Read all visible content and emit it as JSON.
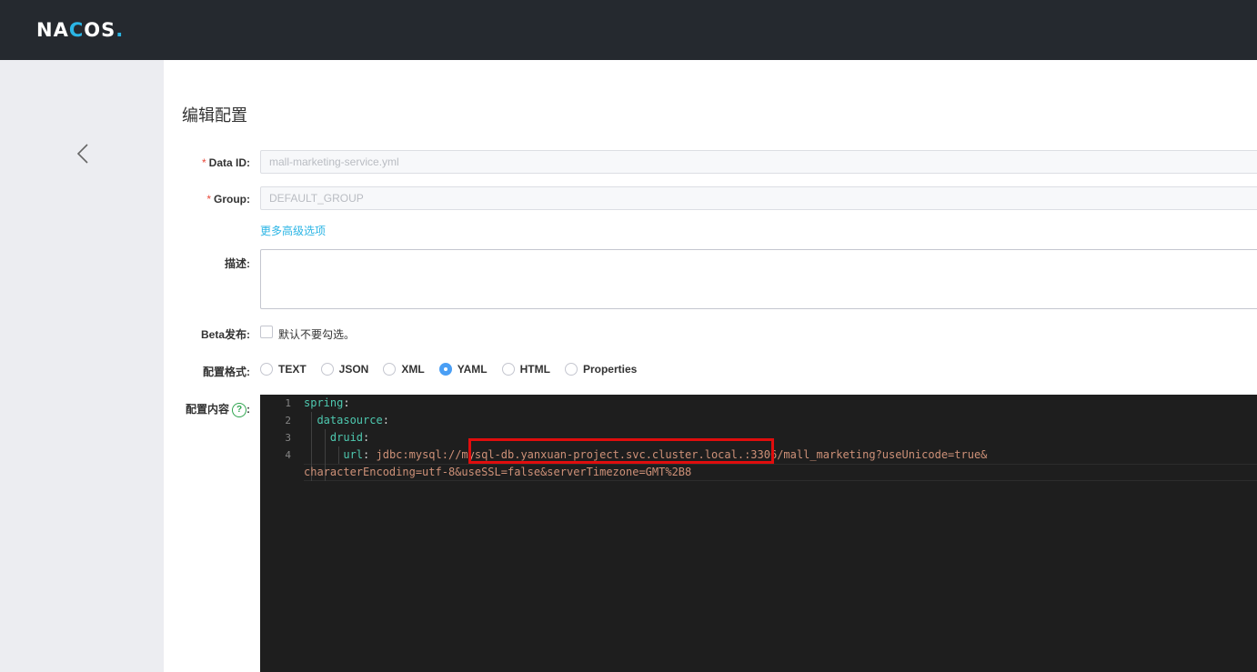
{
  "header": {
    "logo_text_a": "NA",
    "logo_text_o": "C",
    "logo_text_b": "OS",
    "logo_dot": "."
  },
  "page": {
    "title": "编辑配置"
  },
  "form": {
    "data_id": {
      "required_mark": "*",
      "label": "Data ID:",
      "value": "mall-marketing-service.yml"
    },
    "group": {
      "required_mark": "*",
      "label": "Group:",
      "value": "DEFAULT_GROUP"
    },
    "advanced_link": "更多高级选项",
    "description": {
      "label": "描述:",
      "value": ""
    },
    "beta": {
      "label": "Beta发布:",
      "checkbox_label": "默认不要勾选。"
    },
    "format": {
      "label": "配置格式:",
      "options": [
        "TEXT",
        "JSON",
        "XML",
        "YAML",
        "HTML",
        "Properties"
      ],
      "selected": "YAML"
    },
    "content": {
      "label": "配置内容",
      "help_icon": "?",
      "colon": ":"
    }
  },
  "editor": {
    "line_numbers": [
      "1",
      "2",
      "3",
      "4"
    ],
    "lines": [
      {
        "indent": "",
        "key": "spring",
        "sep": ":",
        "value": ""
      },
      {
        "indent": "  ",
        "key": "datasource",
        "sep": ":",
        "value": ""
      },
      {
        "indent": "    ",
        "key": "druid",
        "sep": ":",
        "value": ""
      },
      {
        "indent": "      ",
        "key": "url",
        "sep": ": ",
        "value": "jdbc:mysql://mysql-db.yanxuan-project.svc.cluster.local.:3306/mall_marketing?useUnicode=true&"
      }
    ],
    "wrap_line": "characterEncoding=utf-8&useSSL=false&serverTimezone=GMT%2B8"
  },
  "colors": {
    "accent": "#2bb5e5",
    "highlight_border": "#e00d0d",
    "editor_bg": "#1e1e1e"
  }
}
